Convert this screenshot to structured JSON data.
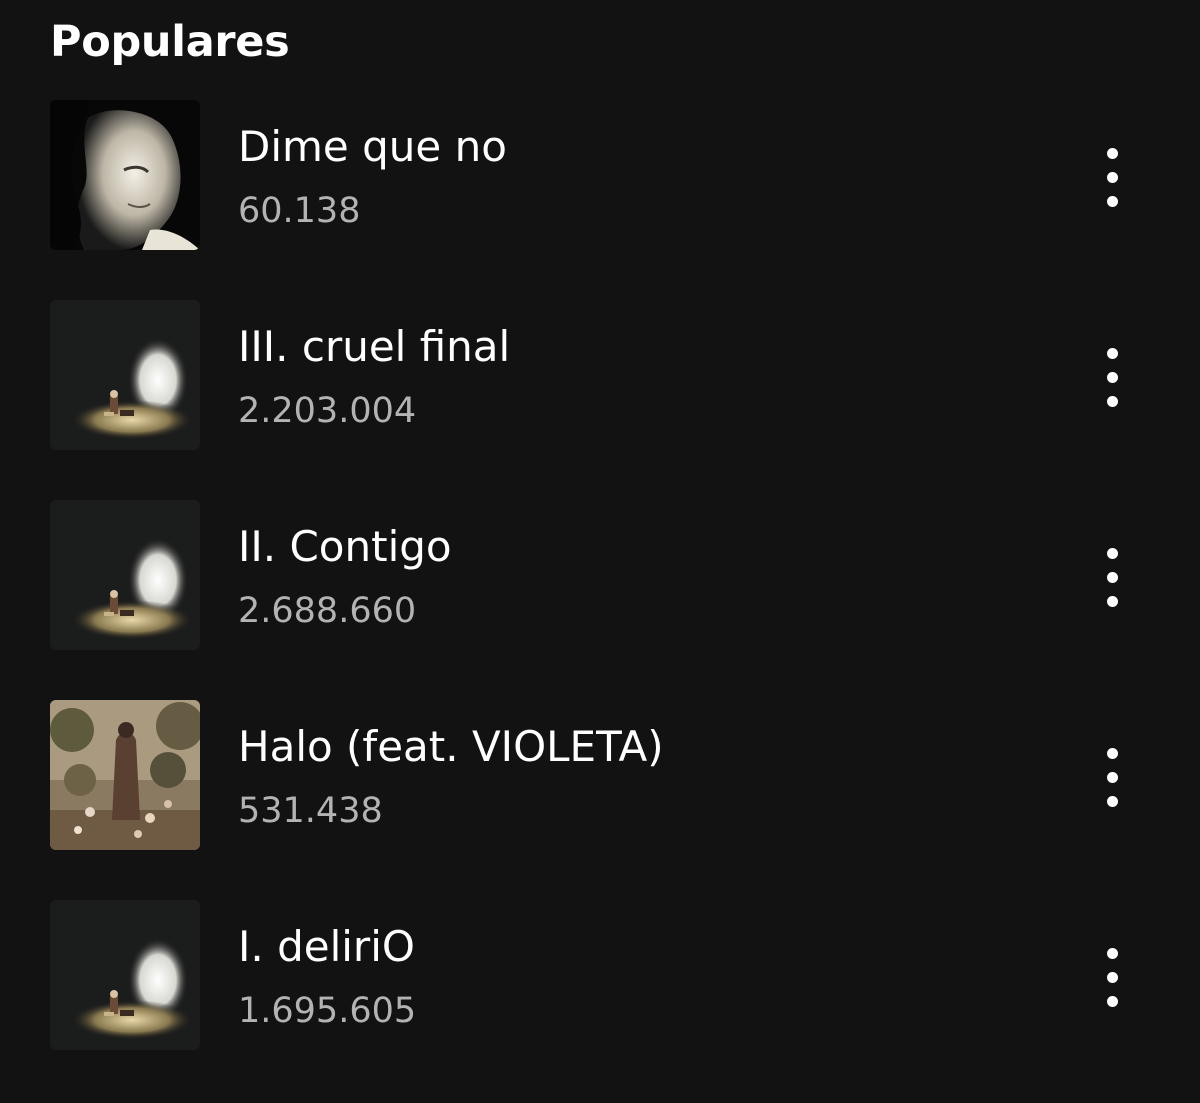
{
  "section": {
    "title": "Populares"
  },
  "tracks": [
    {
      "name": "Dime que no",
      "plays": "60.138",
      "cover": "portrait-cover"
    },
    {
      "name": "III. cruel final",
      "plays": "2.203.004",
      "cover": "dark-room-cover"
    },
    {
      "name": "II. Contigo",
      "plays": "2.688.660",
      "cover": "dark-room-cover"
    },
    {
      "name": "Halo (feat. VIOLETA)",
      "plays": "531.438",
      "cover": "garden-cover"
    },
    {
      "name": "I. deliriO",
      "plays": "1.695.605",
      "cover": "dark-room-cover"
    }
  ],
  "icons": {
    "more": "more-options-icon"
  },
  "colors": {
    "background": "#121212",
    "primary_text": "#ffffff",
    "secondary_text": "#b3b3b3"
  }
}
